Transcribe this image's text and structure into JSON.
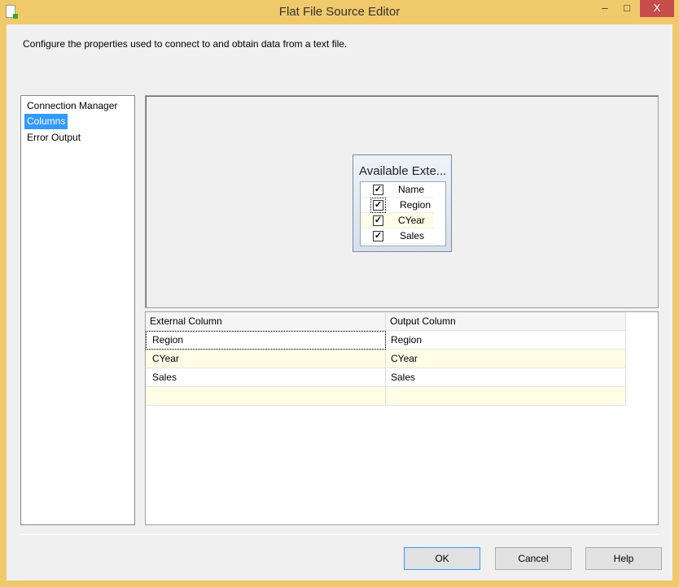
{
  "window": {
    "title": "Flat File Source Editor",
    "min": "–",
    "max": "□",
    "close": "X"
  },
  "description": "Configure the properties used to connect to and obtain data from a text file.",
  "nav": [
    "Connection Manager",
    "Columns",
    "Error Output"
  ],
  "available": {
    "title": "Available Exte...",
    "header": "Name",
    "columns": [
      "Region",
      "CYear",
      "Sales"
    ]
  },
  "grid": {
    "headers": [
      "External Column",
      "Output Column"
    ],
    "rows": [
      [
        "Region",
        "Region"
      ],
      [
        "CYear",
        "CYear"
      ],
      [
        "Sales",
        "Sales"
      ],
      [
        "",
        ""
      ]
    ]
  },
  "buttons": {
    "ok": "OK",
    "cancel": "Cancel",
    "help": "Help"
  },
  "colors": {
    "border": "#f0c96a",
    "selection": "#3399ff",
    "close": "#c74c4c"
  }
}
